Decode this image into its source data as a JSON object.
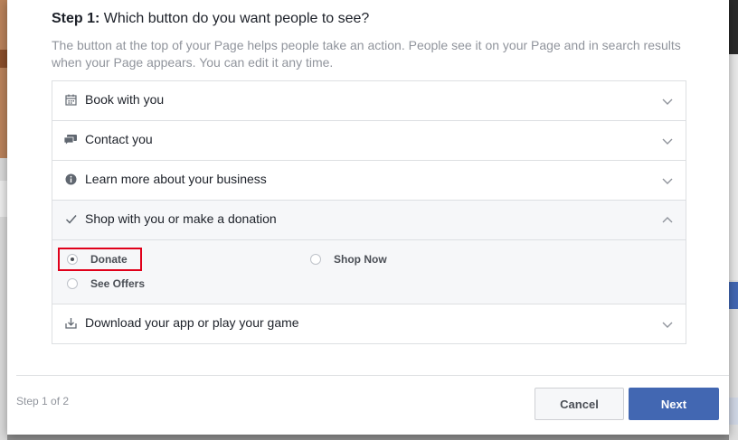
{
  "modal": {
    "title_strong": "Step 1:",
    "title_rest": " Which button do you want people to see?",
    "description": "The button at the top of your Page helps people take an action. People see it on your Page and in search results when your Page appears. You can edit it any time."
  },
  "accordion": {
    "items": [
      {
        "label": "Book with you",
        "icon": "calendar-icon"
      },
      {
        "label": "Contact you",
        "icon": "speech-bubbles-icon"
      },
      {
        "label": "Learn more about your business",
        "icon": "info-icon"
      },
      {
        "label": "Shop with you or make a donation",
        "icon": "checkmark-icon",
        "expanded": true
      },
      {
        "label": "Download your app or play your game",
        "icon": "download-icon"
      }
    ],
    "options": [
      {
        "label": "Donate",
        "selected": true
      },
      {
        "label": "Shop Now",
        "selected": false
      },
      {
        "label": "See Offers",
        "selected": false
      }
    ]
  },
  "footer": {
    "step_text": "Step 1 of 2",
    "cancel_label": "Cancel",
    "next_label": "Next"
  },
  "colors": {
    "primary": "#4267b2",
    "highlight": "#e0001a"
  }
}
